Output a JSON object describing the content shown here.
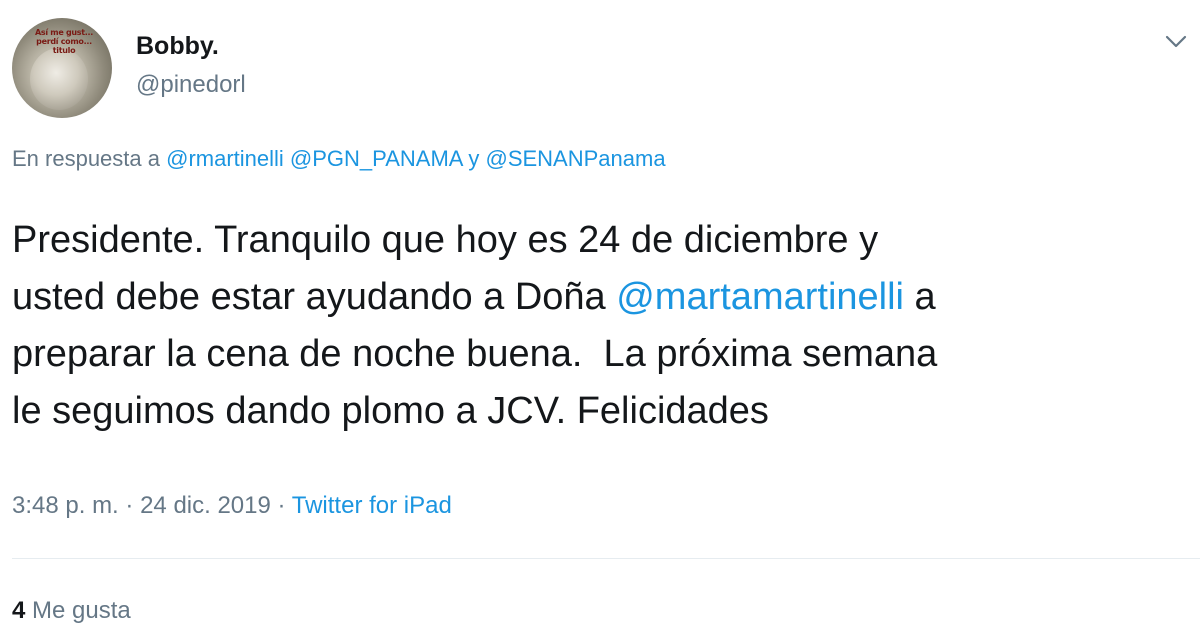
{
  "author": {
    "display_name": "Bobby.",
    "handle": "@pinedorl",
    "avatar_caption": "Así me gust... perdí como... titulo"
  },
  "reply": {
    "prefix": "En respuesta a",
    "mention1": "@rmartinelli",
    "mention2": "@PGN_PANAMA",
    "conjunction": "y",
    "mention3": "@SENANPanama"
  },
  "tweet": {
    "line1": "Presidente. Tranquilo que hoy es 24 de diciembre y",
    "line2_before": "usted debe estar ayudando a Doña ",
    "line2_mention": "@martamartinelli",
    "line2_after": " a",
    "line3": "preparar la cena de noche buena.  La próxima semana",
    "line4": "le seguimos dando plomo a JCV. Felicidades"
  },
  "meta": {
    "time": "3:48 p. m.",
    "separator": "·",
    "date": "24 dic. 2019",
    "source": "Twitter for iPad"
  },
  "likes": {
    "count": "4",
    "label": "Me gusta"
  },
  "icons": {
    "menu": "chevron-down-icon"
  },
  "colors": {
    "link": "#1b95e0",
    "secondary_text": "#657786",
    "primary_text": "#14171a",
    "divider": "#e6ecf0"
  }
}
